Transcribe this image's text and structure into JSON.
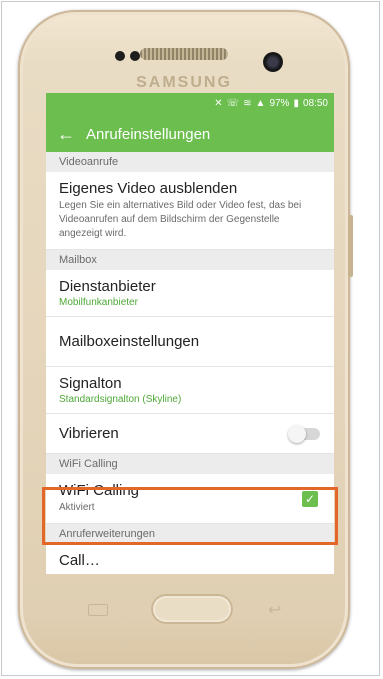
{
  "device": {
    "brand": "SAMSUNG"
  },
  "statusbar": {
    "icons": [
      "mute-icon",
      "vibrate-icon",
      "wifi-icon",
      "signal-icon"
    ],
    "battery": "97%",
    "time": "08:50"
  },
  "actionbar": {
    "back_icon": "arrow-left-icon",
    "title": "Anrufeinstellungen"
  },
  "sections": [
    {
      "header": "Videoanrufe",
      "items": [
        {
          "title": "Eigenes Video ausblenden",
          "summary": "Legen Sie ein alternatives Bild oder Video fest, das bei Videoanrufen auf dem Bildschirm der Gegenstelle angezeigt wird."
        }
      ]
    },
    {
      "header": "Mailbox",
      "items": [
        {
          "title": "Dienstanbieter",
          "value": "Mobilfunkanbieter"
        },
        {
          "title": "Mailboxeinstellungen"
        },
        {
          "title": "Signalton",
          "value": "Standardsignalton (Skyline)"
        },
        {
          "title": "Vibrieren",
          "toggle": false
        }
      ]
    },
    {
      "header": "WiFi Calling",
      "items": [
        {
          "title": "WiFi Calling",
          "summary": "Aktiviert",
          "checked": true
        }
      ]
    },
    {
      "header": "Anruferweiterungen",
      "items": [
        {
          "title": "Call…"
        }
      ]
    }
  ],
  "colors": {
    "accent": "#6cbf4f",
    "highlight": "#e3662a"
  }
}
